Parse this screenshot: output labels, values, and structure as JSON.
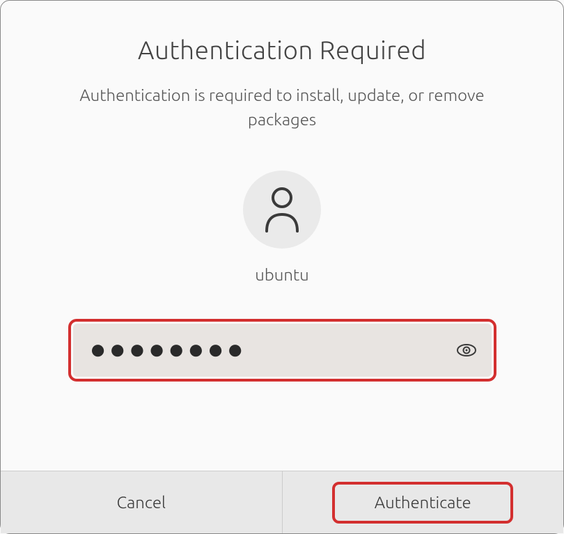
{
  "dialog": {
    "title": "Authentication Required",
    "subtitle": "Authentication is required to install, update, or remove packages",
    "username": "ubuntu",
    "password_value": "●●●●●●●●",
    "cancel_label": "Cancel",
    "authenticate_label": "Authenticate"
  }
}
